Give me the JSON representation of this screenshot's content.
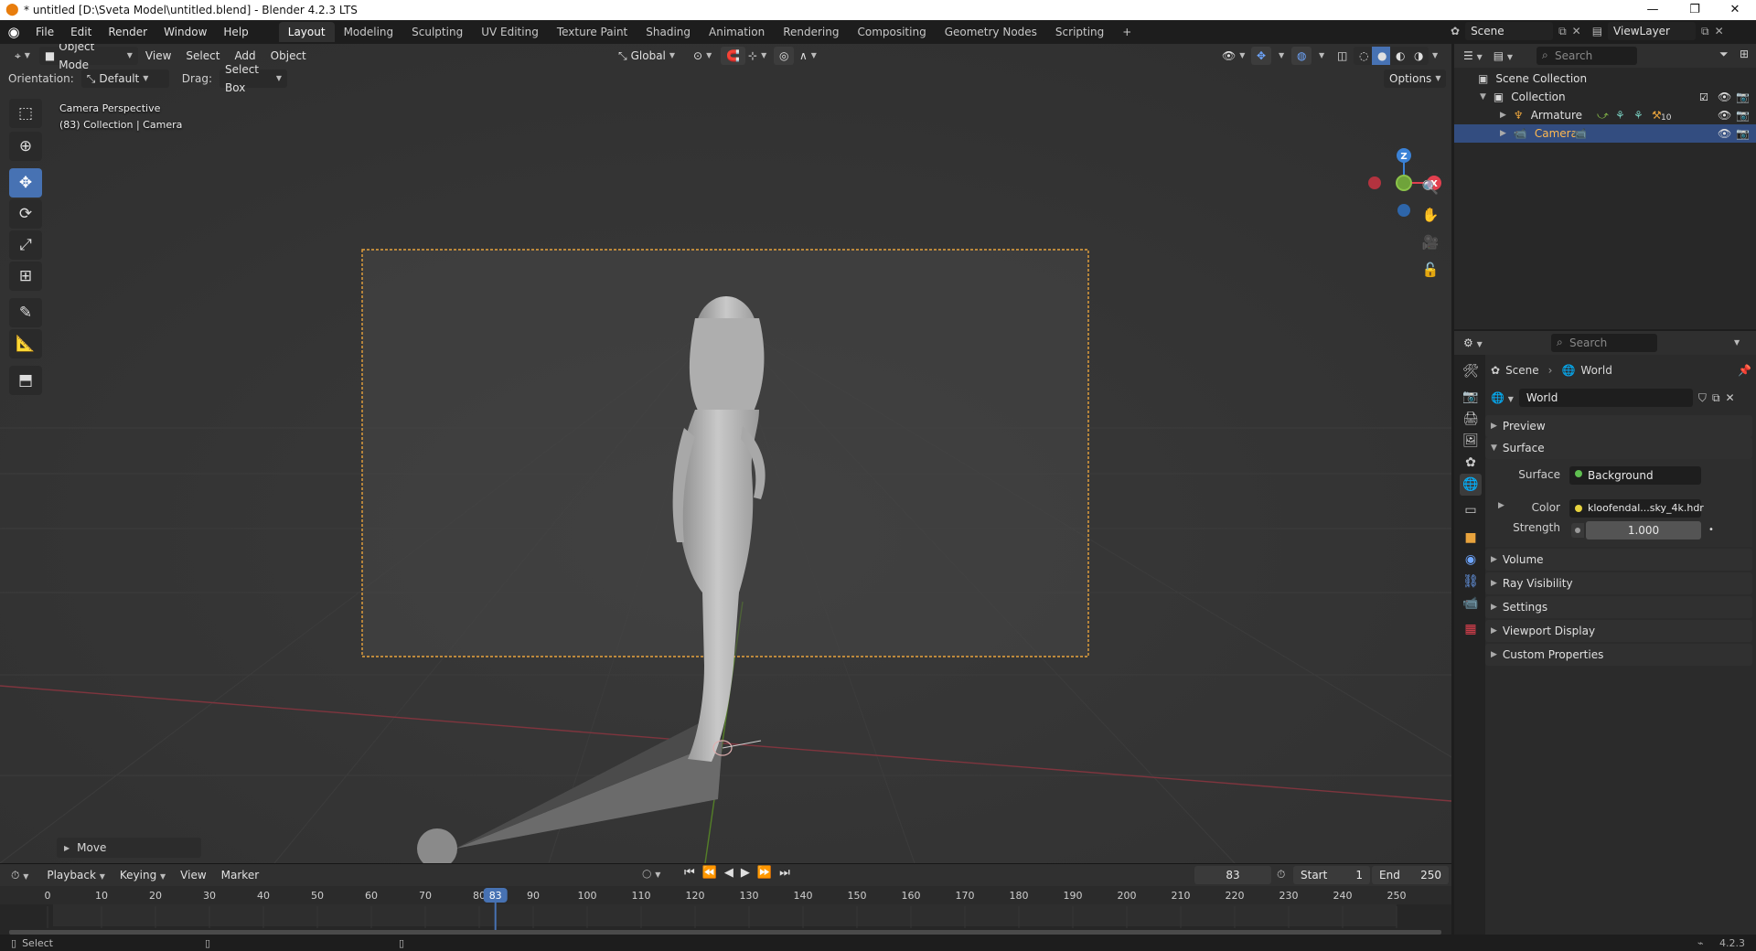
{
  "window": {
    "title": "* untitled [D:\\Sveta Model\\untitled.blend] - Blender 4.2.3 LTS",
    "min": "—",
    "max": "❐",
    "close": "✕"
  },
  "menu": [
    "File",
    "Edit",
    "Render",
    "Window",
    "Help"
  ],
  "workspaces": [
    "Layout",
    "Modeling",
    "Sculpting",
    "UV Editing",
    "Texture Paint",
    "Shading",
    "Animation",
    "Rendering",
    "Compositing",
    "Geometry Nodes",
    "Scripting",
    "+"
  ],
  "top_right": {
    "scene": "Scene",
    "view_layer": "ViewLayer"
  },
  "viewport_header": {
    "mode": "Object Mode",
    "menus": [
      "View",
      "Select",
      "Add",
      "Object"
    ],
    "transform_orientation": "Global",
    "options": "Options"
  },
  "tool_settings": {
    "orientation_label": "Orientation:",
    "orientation_value": "Default",
    "drag_label": "Drag:",
    "drag_value": "Select Box"
  },
  "viewport_overlay": {
    "line1": "Camera Perspective",
    "line2": "(83) Collection | Camera"
  },
  "gizmo": {
    "z": "Z",
    "x": "X"
  },
  "last_operator": "Move",
  "timeline": {
    "menus": [
      "Playback",
      "Keying",
      "View",
      "Marker"
    ],
    "current_frame": "83",
    "start_label": "Start",
    "start": "1",
    "end_label": "End",
    "end": "250",
    "ticks": [
      "0",
      "10",
      "20",
      "30",
      "40",
      "50",
      "60",
      "70",
      "80",
      "90",
      "100",
      "110",
      "120",
      "130",
      "140",
      "150",
      "160",
      "170",
      "180",
      "190",
      "200",
      "210",
      "220",
      "230",
      "240",
      "250"
    ],
    "playhead": 83
  },
  "status": {
    "left": "Select",
    "version": "4.2.3"
  },
  "outliner": {
    "search_placeholder": "Search",
    "scene_collection": "Scene Collection",
    "collection": "Collection",
    "armature": "Armature",
    "camera": "Camera",
    "armature_badge": "10"
  },
  "properties": {
    "search_placeholder": "Search",
    "breadcrumb_scene": "Scene",
    "breadcrumb_world": "World",
    "world_name": "World",
    "panels": {
      "preview": "Preview",
      "surface": "Surface",
      "volume": "Volume",
      "ray_visibility": "Ray Visibility",
      "settings": "Settings",
      "viewport_display": "Viewport Display",
      "custom_properties": "Custom Properties"
    },
    "surface_label": "Surface",
    "surface_value": "Background",
    "color_label": "Color",
    "color_value": "kloofendal...sky_4k.hdr",
    "strength_label": "Strength",
    "strength_value": "1.000"
  },
  "colors": {
    "accent": "#4772b3",
    "camera_frame": "#e8a33d",
    "selected_row": "#334d80",
    "axis_x": "#e2404f",
    "axis_y": "#8bc34a",
    "axis_z": "#3b82d6"
  }
}
